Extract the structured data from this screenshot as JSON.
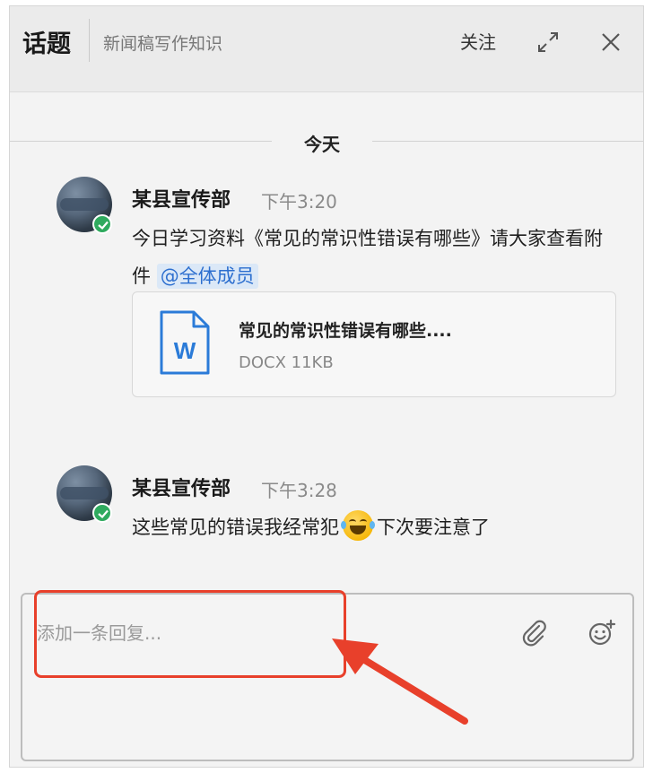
{
  "header": {
    "title": "话题",
    "subtitle": "新闻稿写作知识",
    "follow_label": "关注"
  },
  "divider": {
    "label": "今天"
  },
  "messages": [
    {
      "sender": "某县宣传部",
      "time": "下午3:20",
      "text": "今日学习资料《常见的常识性错误有哪些》请大家查看附件",
      "mention": "@全体成员",
      "attachment": {
        "name": "常见的常识性错误有哪些....",
        "type": "DOCX",
        "size": "11KB",
        "meta": "DOCX 11KB",
        "icon_letter": "W"
      }
    },
    {
      "sender": "某县宣传部",
      "time": "下午3:28",
      "text_before": "这些常见的错误我经常犯",
      "emoji": "laughing-tears-emoji",
      "text_after": "下次要注意了"
    }
  ],
  "reply": {
    "placeholder": "添加一条回复...",
    "value": ""
  },
  "icons": {
    "expand": "expand-icon",
    "close": "close-icon",
    "attach": "paperclip-icon",
    "emoji": "smiley-add-icon",
    "online": "check-badge-icon",
    "file": "word-doc-icon"
  },
  "colors": {
    "accent_red": "#e8402b",
    "mention_blue": "#2d6fcf",
    "file_blue": "#2b7bd8",
    "online_green": "#2faa5e"
  }
}
